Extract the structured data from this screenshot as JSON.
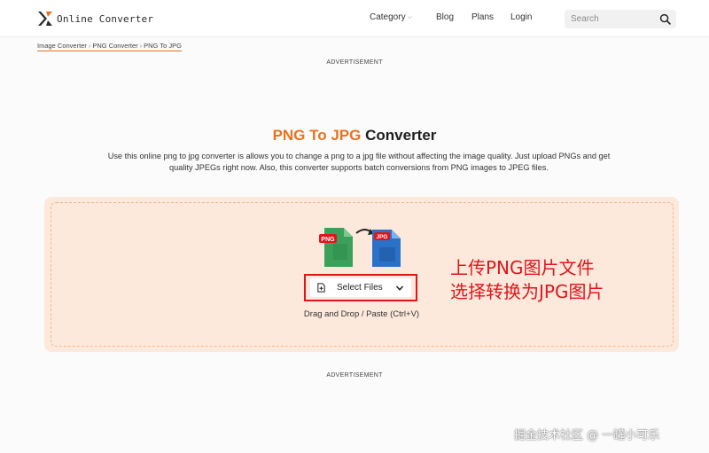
{
  "header": {
    "brand": "Online Converter",
    "nav": {
      "category": "Category",
      "blog": "Blog",
      "plans": "Plans",
      "login": "Login"
    },
    "search": {
      "placeholder": "Search",
      "value": ""
    }
  },
  "breadcrumb": [
    "Image Converter",
    "PNG Converter",
    "PNG To JPG"
  ],
  "ads": {
    "top": "ADVERTISEMENT",
    "bottom": "ADVERTISEMENT"
  },
  "main": {
    "title_highlight": "PNG To JPG",
    "title_rest": "Converter",
    "description": "Use this online png to jpg converter is allows you to change a png to a jpg file without affecting the image quality. Just upload PNGs and get quality JPEGs right now. Also, this converter supports batch conversions from PNG images to JPEG files.",
    "icons": {
      "from_label": "PNG",
      "to_label": "JPG"
    },
    "select_files": "Select Files",
    "drag_drop": "Drag and Drop / Paste (Ctrl+V)"
  },
  "annotation": {
    "line1": "上传PNG图片文件",
    "line2": "选择转换为JPG图片"
  },
  "watermark": "掘金技术社区 @ 一罐小可乐",
  "colors": {
    "accent": "#e8731e",
    "annotation_red": "#e0141b",
    "dropzone_bg": "#fde9dc",
    "png_green": "#3aa05a",
    "jpg_blue": "#2a72c8"
  }
}
